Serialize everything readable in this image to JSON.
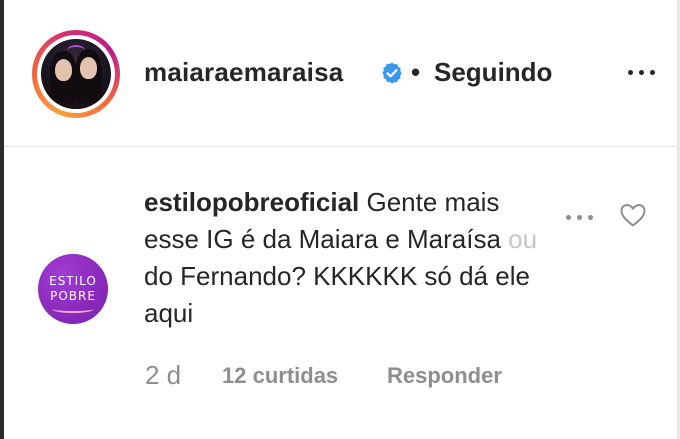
{
  "header": {
    "username": "maiaraemaraisa",
    "separator": "•",
    "follow_status": "Seguindo",
    "verified": true
  },
  "comment": {
    "username": "estilopobreoficial",
    "text_line1": " Gente mais",
    "text_line2": "esse IG é da Maiara e Maraísa ",
    "text_faded": "ou",
    "text_line3": "do Fernando? KKKKKK só dá ele",
    "text_line4": "aqui",
    "avatar_line1": "ESTILO",
    "avatar_line2": "POBRE",
    "time": "2 d",
    "likes": "12 curtidas",
    "reply_label": "Responder"
  },
  "colors": {
    "text": "#262626",
    "muted": "#8e8e8e",
    "verified_blue": "#3897f0",
    "brand_purple": "#8a2bbd"
  },
  "icons": [
    "verified-badge-icon",
    "more-options-icon",
    "heart-icon"
  ]
}
